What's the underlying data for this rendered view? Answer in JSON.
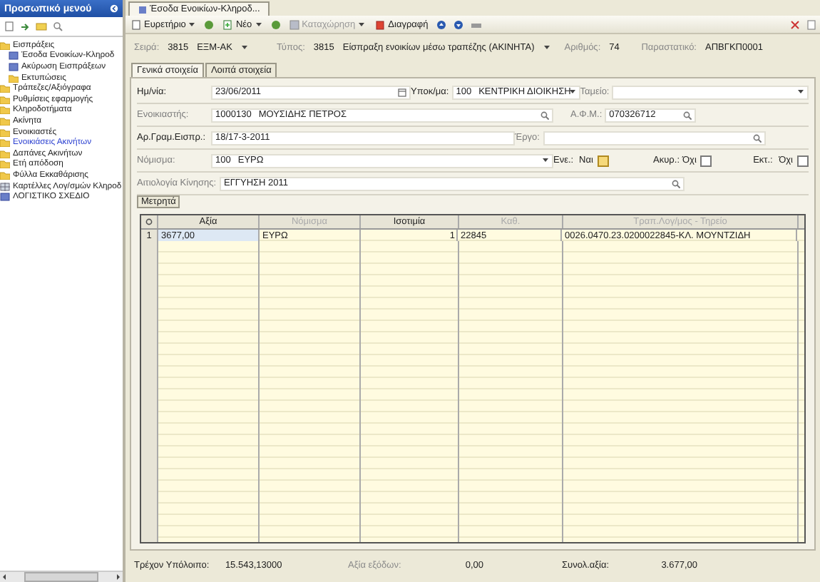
{
  "sidebar": {
    "title": "Προσωπικό μενού",
    "items": [
      {
        "label": "Εισπράξεις",
        "kind": "folder",
        "selected": false,
        "expanded": true,
        "children": [
          {
            "label": "Έσοδα Ενοικίων-Κληροδ",
            "kind": "form",
            "selected": false
          },
          {
            "label": "Ακύρωση Εισπράξεων",
            "kind": "form",
            "selected": false
          },
          {
            "label": "Εκτυπώσεις",
            "kind": "folder",
            "selected": false
          }
        ]
      },
      {
        "label": "Τράπεζες/Αξιόγραφα",
        "kind": "folder",
        "selected": false
      },
      {
        "label": "Ρυθμίσεις εφαρμογής",
        "kind": "folder",
        "selected": false
      },
      {
        "label": "Κληροδοτήματα",
        "kind": "folder",
        "selected": false
      },
      {
        "label": "Ακίνητα",
        "kind": "folder",
        "selected": false
      },
      {
        "label": "Ενοικιαστές",
        "kind": "folder",
        "selected": false
      },
      {
        "label": "Ενοικιάσεις Ακινήτων",
        "kind": "folder",
        "selected": true
      },
      {
        "label": "Δαπάνες Ακινήτων",
        "kind": "folder",
        "selected": false
      },
      {
        "label": "Ετή απόδοση",
        "kind": "folder",
        "selected": false
      },
      {
        "label": "Φύλλα Εκκαθάρισης",
        "kind": "folder",
        "selected": false
      },
      {
        "label": "Καρτέλλες Λογ/σμών Κληροδ",
        "kind": "table",
        "selected": false
      },
      {
        "label": "ΛΟΓΙΣΤΙΚΟ ΣΧΕΔΙΟ",
        "kind": "form",
        "selected": false
      }
    ]
  },
  "document_tab": {
    "title": "Έσοδα Ενοικίων-Κληροδ..."
  },
  "toolbar": [
    {
      "label": "Ευρετήριο",
      "kind": "index",
      "disabled": false
    },
    {
      "label": "Νέο",
      "kind": "new",
      "disabled": false
    },
    {
      "label": "Καταχώρηση",
      "kind": "save",
      "disabled": true
    },
    {
      "label": "Διαγραφή",
      "kind": "delete",
      "disabled": false
    }
  ],
  "header": [
    {
      "label": "Σειρά:",
      "code": "3815",
      "value": "ΕΞΜ-ΑΚ"
    },
    {
      "label": "Τύπος:",
      "code": "3815",
      "value": "Είσπραξη ενοικίων μέσω τραπέζης (ΑΚΙΝΗΤΑ)"
    },
    {
      "label": "Αριθμός:",
      "value": "74"
    },
    {
      "label": "Παραστατικό:",
      "value": "ΑΠΒΓΚΠ0001"
    }
  ],
  "form_tabs": [
    {
      "label": "Γενικά στοιχεία",
      "selected": true
    },
    {
      "label": "Λοιπά στοιχεία",
      "selected": false
    }
  ],
  "form_rows": [
    [
      {
        "label": "Ημ/νία:",
        "muted": false,
        "kind": "date",
        "value": "23/06/2011"
      },
      {
        "label": "Υποκ/μα:",
        "muted": false,
        "kind": "dropdown",
        "code": "100",
        "value": "ΚΕΝΤΡΙΚΗ ΔΙΟΙΚΗΣΗ"
      },
      {
        "label": "Ταμείο:",
        "muted": true,
        "kind": "dropdown"
      }
    ],
    [
      {
        "label": "Ενοικιαστής:",
        "muted": true,
        "kind": "lookup",
        "code": "1000130",
        "value": "ΜΟΥΣΙΔΗΣ ΠΕΤΡΟΣ"
      },
      {
        "label": "Α.Φ.Μ.:",
        "muted": true,
        "kind": "lookup",
        "value": "070326712"
      }
    ],
    [
      {
        "label": "Αρ.Γραμ.Εισπρ.:",
        "muted": false,
        "kind": "text",
        "value": "18/17-3-2011"
      },
      {
        "label": "Έργο:",
        "muted": true,
        "kind": "lookup"
      }
    ],
    [
      {
        "label": "Νόμισμα:",
        "muted": true,
        "kind": "dropdown",
        "code": "100",
        "value": "ΕΥΡΩ"
      },
      {
        "label": "Ενε.:",
        "muted": false,
        "kind": "checkbox",
        "value": "Ναι",
        "checked": true
      },
      {
        "label": "Ακυρ.:",
        "muted": false,
        "kind": "checkbox",
        "value": "Όχι",
        "checked": false
      },
      {
        "label": "Εκτ.:",
        "muted": false,
        "kind": "checkbox",
        "value": "Όχι",
        "checked": false
      }
    ],
    [
      {
        "label": "Αιτιολογία Κίνησης:",
        "muted": true,
        "kind": "lookup",
        "value": "ΕΓΓΥΗΣΗ 2011"
      }
    ]
  ],
  "section_button": "Μετρητά",
  "table": {
    "columns": [
      {
        "label": "Αξία",
        "muted": false
      },
      {
        "label": "Νόμισμα",
        "muted": true
      },
      {
        "label": "Ισοτιμία",
        "muted": false
      },
      {
        "label": "Καθ.",
        "muted": true
      },
      {
        "label": "Τραπ.Λογ/μος - Τηρείο",
        "muted": true
      }
    ],
    "rows": [
      {
        "number": "1",
        "cells": [
          "3677,00",
          "ΕΥΡΩ",
          "1",
          "22845",
          "0026.0470.23.0200022845-ΚΛ. ΜΟΥΝΤΖΙΔΗ"
        ]
      }
    ]
  },
  "totals": [
    {
      "label": "Τρέχον Υπόλοιπο:",
      "value": "15.543,13000",
      "muted": false
    },
    {
      "label": "Αξία εξόδων:",
      "value": "0,00",
      "muted": true
    },
    {
      "label": "Συνολ.αξία:",
      "value": "3.677,00",
      "muted": false
    }
  ]
}
